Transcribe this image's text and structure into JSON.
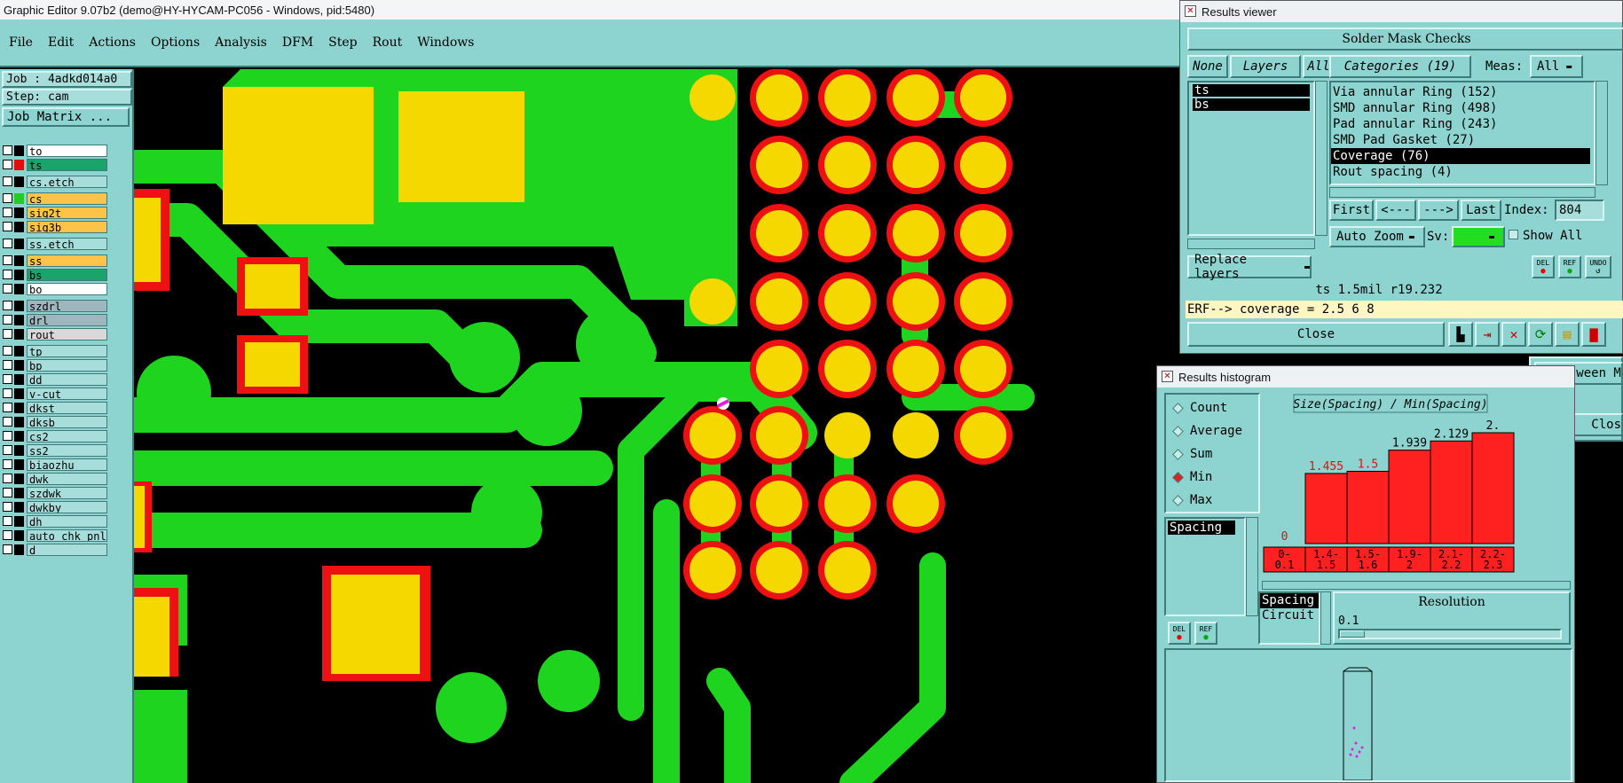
{
  "app_title": "Graphic Editor 9.07b2 (demo@HY-HYCAM-PC056 - Windows, pid:5480)",
  "menu": [
    "File",
    "Edit",
    "Actions",
    "Options",
    "Analysis",
    "DFM",
    "Step",
    "Rout",
    "Windows"
  ],
  "job_label": "Job : 4adkd014a0",
  "step_label": "Step: cam",
  "job_matrix_button": "Job Matrix ...",
  "layers": [
    {
      "name": "to",
      "color": "#ffffff",
      "swatch": "#000000"
    },
    {
      "name": "ts",
      "color": "#1aa36a",
      "swatch": "#e01010"
    },
    {
      "name": "cs.etch",
      "color": "#a7dedb",
      "swatch": "#000000"
    },
    {
      "name": "cs",
      "color": "#ffc34a",
      "swatch": "#22cc22"
    },
    {
      "name": "sig2t",
      "color": "#ffc34a",
      "swatch": "#000000"
    },
    {
      "name": "sig3b",
      "color": "#ffc34a",
      "swatch": "#000000"
    },
    {
      "name": "ss.etch",
      "color": "#a7dedb",
      "swatch": "#000000"
    },
    {
      "name": "ss",
      "color": "#ffc34a",
      "swatch": "#000000"
    },
    {
      "name": "bs",
      "color": "#1aa36a",
      "swatch": "#000000"
    },
    {
      "name": "bo",
      "color": "#ffffff",
      "swatch": "#000000"
    },
    {
      "name": "szdrl",
      "color": "#9fb6bf",
      "swatch": "#000000"
    },
    {
      "name": "drl",
      "color": "#9fb6bf",
      "swatch": "#000000"
    },
    {
      "name": "rout",
      "color": "#d9d9d9",
      "swatch": "#000000"
    },
    {
      "name": "tp",
      "color": "#a7dedb",
      "swatch": "#000000"
    },
    {
      "name": "bp",
      "color": "#a7dedb",
      "swatch": "#000000"
    },
    {
      "name": "dd",
      "color": "#a7dedb",
      "swatch": "#000000"
    },
    {
      "name": "v-cut",
      "color": "#a7dedb",
      "swatch": "#000000"
    },
    {
      "name": "dkst",
      "color": "#a7dedb",
      "swatch": "#000000"
    },
    {
      "name": "dksb",
      "color": "#a7dedb",
      "swatch": "#000000"
    },
    {
      "name": "cs2",
      "color": "#a7dedb",
      "swatch": "#000000"
    },
    {
      "name": "ss2",
      "color": "#a7dedb",
      "swatch": "#000000"
    },
    {
      "name": "biaozhu",
      "color": "#a7dedb",
      "swatch": "#000000"
    },
    {
      "name": "dwk",
      "color": "#a7dedb",
      "swatch": "#000000"
    },
    {
      "name": "szdwk",
      "color": "#a7dedb",
      "swatch": "#000000"
    },
    {
      "name": "dwkby",
      "color": "#a7dedb",
      "swatch": "#000000"
    },
    {
      "name": "dh",
      "color": "#a7dedb",
      "swatch": "#000000"
    },
    {
      "name": "auto_chk_pnl",
      "color": "#a7dedb",
      "swatch": "#000000"
    },
    {
      "name": "d",
      "color": "#a7dedb",
      "swatch": "#000000"
    }
  ],
  "results_viewer": {
    "title": "Results viewer",
    "header": "Solder Mask Checks",
    "none_btn": "None",
    "layers_btn": "Layers",
    "all_btn": "All",
    "layer_list": [
      "ts",
      "bs"
    ],
    "categories_btn": "Categories (19)",
    "meas_label": "Meas:",
    "meas_value": "All",
    "categories": [
      "Via annular Ring (152)",
      "SMD annular Ring (498)",
      "Pad annular Ring (243)",
      "SMD Pad Gasket (27)",
      "Coverage (76)",
      "Rout spacing (4)"
    ],
    "selected_category": 4,
    "first_btn": "First",
    "prev_btn": "<---",
    "next_btn": "--->",
    "last_btn": "Last",
    "index_label": "Index:",
    "index_value": "804",
    "auto_zoom": "Auto Zoom",
    "sv_label": "Sv:",
    "show_all": "Show All",
    "replace_layers": "Replace layers",
    "status": "ts 1.5mil  r19.232",
    "erf_line": "ERF--> coverage = 2.5 6 8",
    "close_btn": "Close",
    "del_label": "DEL",
    "ref_label": "REF",
    "undo_label": "UNDO"
  },
  "histogram": {
    "title": "Results histogram",
    "options": [
      "Count",
      "Average",
      "Sum",
      "Min",
      "Max"
    ],
    "selected_option": "Min",
    "list_label": "Spacing",
    "chart_title": "Size(Spacing) / Min(Spacing)",
    "resolution_label": "Resolution",
    "resolution_value": "0.1",
    "group_list": [
      "Spacing",
      "Circuit"
    ],
    "del_label": "DEL",
    "ref_label": "REF"
  },
  "chart_data": {
    "type": "bar",
    "categories": [
      "0-0.1",
      "1.4-1.5",
      "1.5-1.6",
      "1.9-2",
      "2.1-2.2",
      "2.2-2.3"
    ],
    "category_lines": [
      [
        "0-",
        "0.1"
      ],
      [
        "1.4-",
        "1.5"
      ],
      [
        "1.5-",
        "1.6"
      ],
      [
        "1.9-",
        "2"
      ],
      [
        "2.1-",
        "2.2"
      ],
      [
        "2.2-",
        "2.3"
      ]
    ],
    "values": [
      0,
      1.455,
      1.5,
      1.939,
      2.129,
      2.3
    ],
    "value_labels": [
      "0",
      "1.455",
      "1.5",
      "1.939",
      "2.129",
      "2."
    ],
    "title": "Size(Spacing) / Min(Spacing)",
    "ylim": [
      0,
      2.3
    ],
    "bar_color": "#ff2020"
  },
  "third_panel": {
    "between_label": "Between M",
    "close_label": "Clos"
  }
}
